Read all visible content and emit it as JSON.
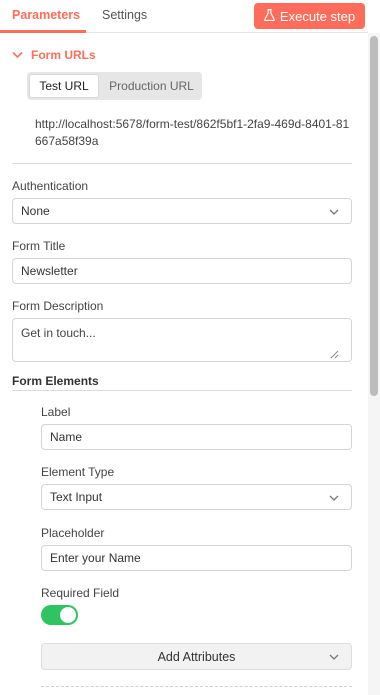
{
  "tabs": [
    {
      "label": "Parameters",
      "active": true
    },
    {
      "label": "Settings",
      "active": false
    }
  ],
  "execute_button": {
    "label": "Execute step",
    "icon": "flask-icon"
  },
  "form_urls": {
    "title": "Form URLs",
    "options": [
      "Test URL",
      "Production URL"
    ],
    "selected": "Test URL",
    "url": "http://localhost:5678/form-test/862f5bf1-2fa9-469d-8401-81667a58f39a"
  },
  "authentication": {
    "label": "Authentication",
    "value": "None"
  },
  "form_title": {
    "label": "Form Title",
    "value": "Newsletter"
  },
  "form_description": {
    "label": "Form Description",
    "value": "Get in touch..."
  },
  "form_elements": {
    "heading": "Form Elements",
    "element": {
      "label_label": "Label",
      "label_value": "Name",
      "type_label": "Element Type",
      "type_value": "Text Input",
      "placeholder_label": "Placeholder",
      "placeholder_value": "Enter your Name",
      "required_label": "Required Field",
      "required": true,
      "add_attributes": "Add Attributes"
    }
  },
  "colors": {
    "accent": "#ff6d5a",
    "toggle_on": "#2ec461"
  }
}
